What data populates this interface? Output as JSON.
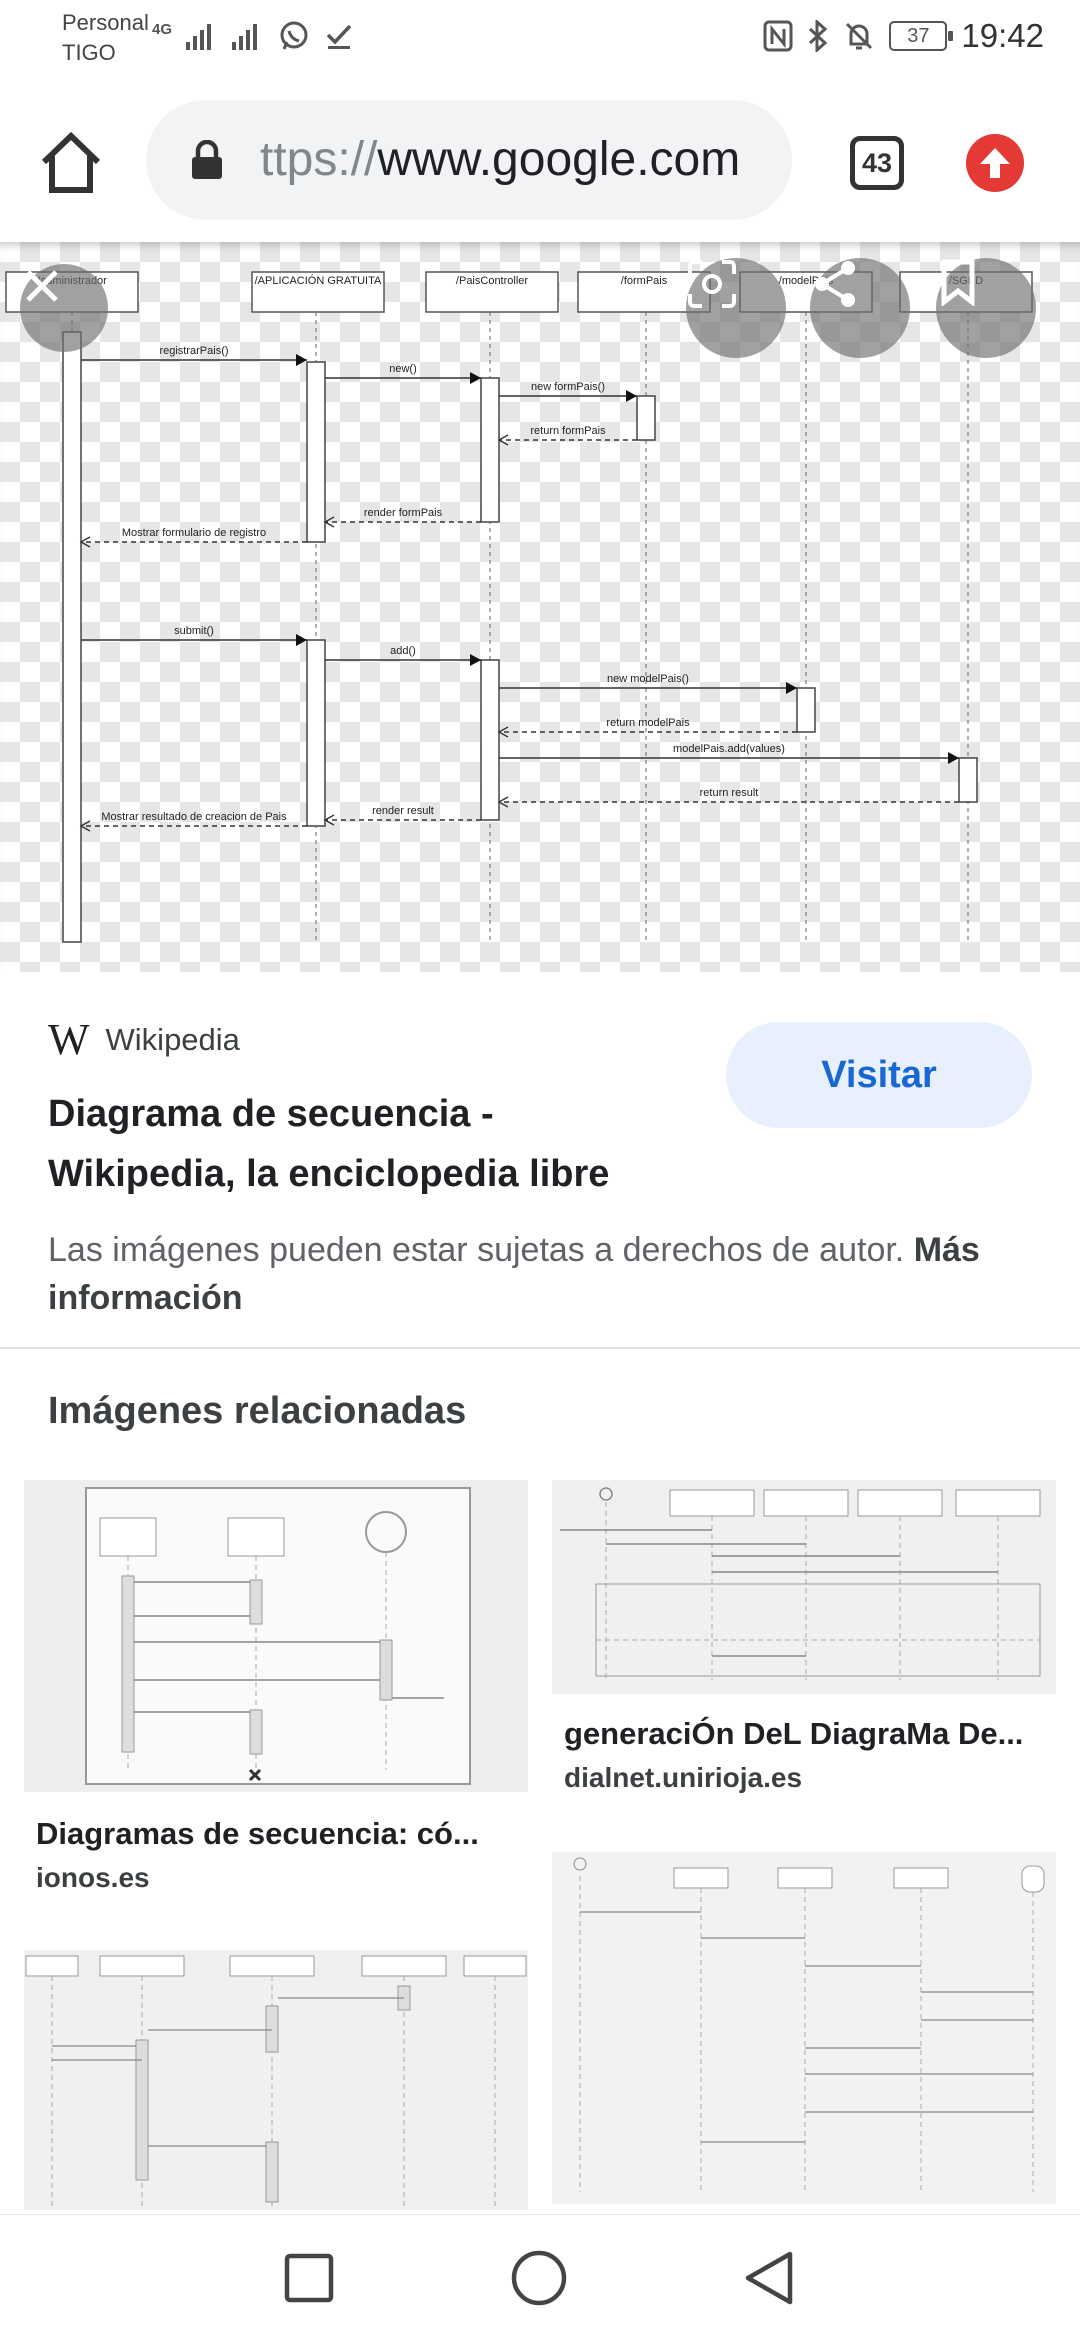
{
  "status_bar": {
    "carrier_line1": "Personal",
    "carrier_line2": "TIGO",
    "network_type": "4G",
    "battery_level": "37",
    "time": "19:42"
  },
  "browser": {
    "url_scheme": "ttps://",
    "url_host": "www.google.com",
    "tab_count": "43"
  },
  "diagram": {
    "lifelines": [
      "/administrador",
      "/APLICACIÓN GRATUITA",
      "/PaisController",
      "/formPais",
      "/modelPais",
      "/SGBD"
    ],
    "messages": [
      "registrarPais()",
      "new()",
      "new formPais()",
      "return formPais",
      "render formPais",
      "Mostrar formulario de registro",
      "submit()",
      "add()",
      "new modelPais()",
      "return modelPais",
      "modelPais.add(values)",
      "return result",
      "render result",
      "Mostrar resultado de creacion de Pais"
    ]
  },
  "result": {
    "source_logo": "W",
    "source_name": "Wikipedia",
    "title": "Diagrama de secuencia - Wikipedia, la enciclopedia libre",
    "visit_label": "Visitar",
    "copyright_text": "Las imágenes pueden estar sujetas a derechos de autor.",
    "more_info_label": "Más información"
  },
  "related": {
    "heading": "Imágenes relacionadas",
    "cards": [
      {
        "title": "Diagramas de secuencia: có...",
        "domain": "ionos.es"
      },
      {
        "title": "generaciÓn DeL DiagraMa De...",
        "domain": "dialnet.unirioja.es"
      }
    ]
  }
}
